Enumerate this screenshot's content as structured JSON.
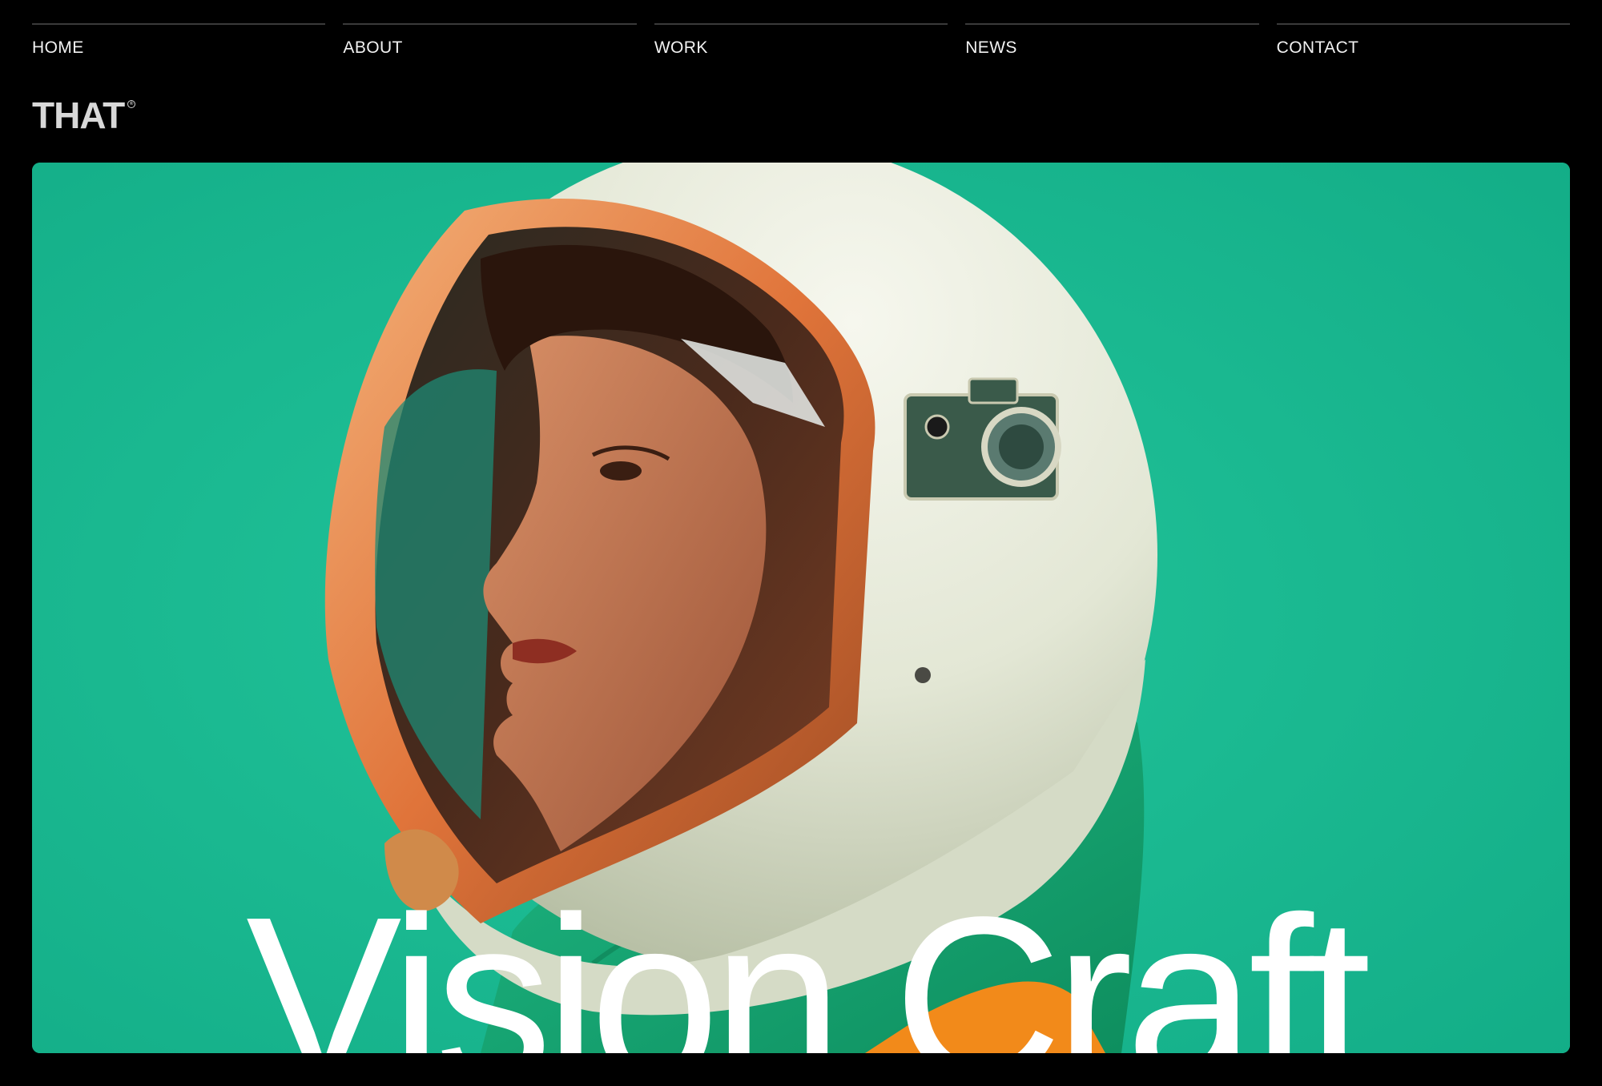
{
  "nav": {
    "items": [
      {
        "label": "HOME"
      },
      {
        "label": "ABOUT"
      },
      {
        "label": "WORK"
      },
      {
        "label": "NEWS"
      },
      {
        "label": "CONTACT"
      }
    ]
  },
  "brand": {
    "logo_text": "THAT",
    "registered_mark": "®"
  },
  "hero": {
    "title": "Vision Craft",
    "image_subject": "portrait of a woman in a white retro space helmet with orange visor and green collar on a teal background",
    "colors": {
      "background": "#1ab991",
      "helmet": "#e6ead8",
      "visor_rim": "#e07a3a",
      "collar": "#17a874",
      "orange_suit": "#f28a1a",
      "title_text": "#ffffff"
    }
  },
  "colors": {
    "page_background": "#000000",
    "nav_text": "#f2f2f2",
    "nav_rule": "#3a3a3a"
  }
}
